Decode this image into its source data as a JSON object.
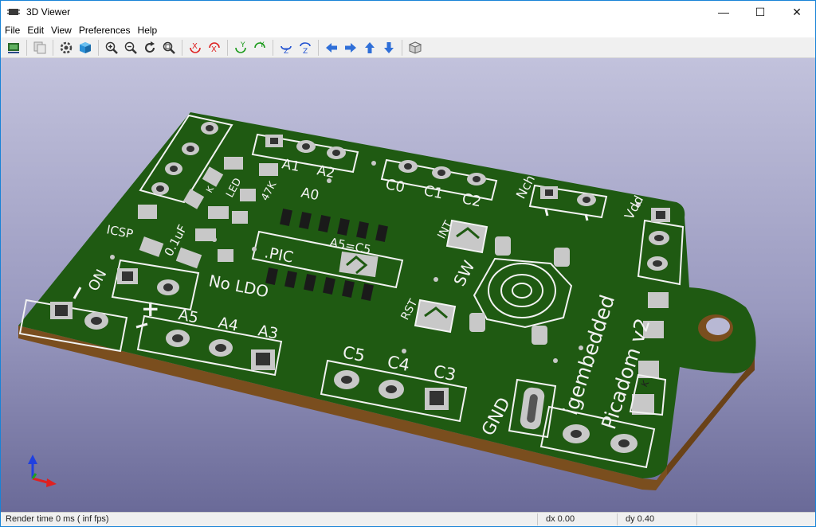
{
  "window": {
    "title": "3D Viewer",
    "controls": {
      "minimize": "—",
      "maximize": "☐",
      "close": "✕"
    }
  },
  "menu": [
    "File",
    "Edit",
    "View",
    "Preferences",
    "Help"
  ],
  "toolbar": {
    "buttons": [
      "reload-board-icon",
      "copy-image-icon",
      "render-options-icon",
      "raytracing-cube-icon",
      "zoom-in-icon",
      "zoom-out-icon",
      "redraw-icon",
      "zoom-fit-icon",
      "rotate-x-cw-icon",
      "rotate-x-ccw-icon",
      "rotate-y-cw-icon",
      "rotate-y-ccw-icon",
      "rotate-z-cw-icon",
      "rotate-z-ccw-icon",
      "pan-left-icon",
      "pan-right-icon",
      "pan-up-icon",
      "pan-down-icon",
      "projection-toggle-icon"
    ],
    "rotate_labels": {
      "x": "X",
      "y": "Y",
      "z": "Z"
    }
  },
  "board": {
    "colors": {
      "mask": "#1f5a12",
      "edge": "#7a4e1e",
      "silk": "#f2f2f2",
      "copper": "#c8c8c8"
    },
    "labels": {
      "a1": "A1",
      "a2": "A2",
      "a0": "A0",
      "c0": "C0",
      "c1": "C1",
      "c2": "C2",
      "nch": "Nch",
      "vdd": "Vdd",
      "led": "LED",
      "k_led": "K",
      "r47k": "47K",
      "cap": "0.1uF",
      "icsp": "ICSP",
      "pic": ".PIC",
      "a5c5": "A5=C5",
      "int": "INT",
      "sw": "SW",
      "on": "ON",
      "no_ldo": "No LDO",
      "rst": "RST",
      "plus": "+",
      "a5": "A5",
      "a4": "A4",
      "a3": "A3",
      "c5": "C5",
      "c4": "C4",
      "c3": "C3",
      "gnd": "GND",
      "brand1": "igembedded",
      "brand2": "Picadom v2",
      "k_diode": "K"
    }
  },
  "axes": {
    "x_color": "#e02020",
    "y_color": "#20a020",
    "z_color": "#2040e0"
  },
  "status": {
    "render": "Render time 0 ms ( inf fps)",
    "dx": "dx 0.00",
    "dy": "dy 0.40"
  }
}
